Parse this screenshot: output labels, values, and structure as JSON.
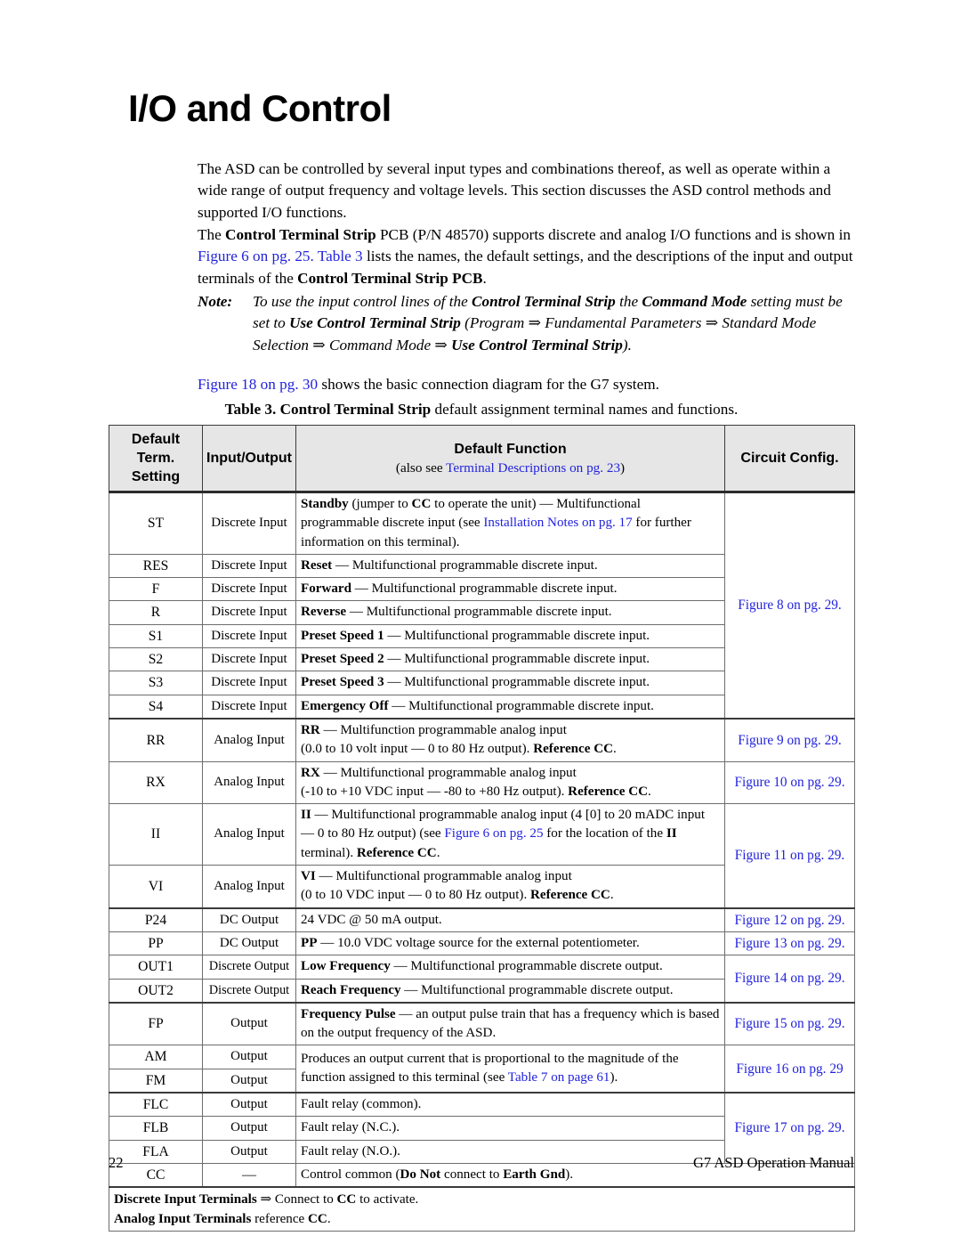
{
  "heading": "I/O and Control",
  "paragraphs": {
    "intro": "The ASD can be controlled by several input types and combinations thereof, as well as operate within a wide range of output frequency and voltage levels. This section discusses the ASD control methods and supported I/O functions.",
    "strip_p1": "The ",
    "strip_b1": "Control Terminal Strip",
    "strip_p2": " PCB (P/N 48570) supports discrete and analog I/O functions and is shown in ",
    "strip_link1": "Figure 6 on pg. 25.",
    "strip_link2": "Table 3",
    "strip_p3": " lists the names, the default settings, and the descriptions of the input and output terminals of the ",
    "strip_b2": "Control Terminal Strip PCB",
    "strip_p4": ".",
    "fig18_link": "Figure 18 on pg. 30",
    "fig18_rest": " shows the basic connection diagram for the G7 system."
  },
  "note": {
    "label": "Note:",
    "seg1": "To use the input control lines of the ",
    "seg2_b": "Control Terminal Strip",
    "seg3": " the ",
    "seg4_b": "Command Mode",
    "seg5": " setting must be set to ",
    "seg6_b": "Use Control Terminal Strip",
    "seg7": " (Program ⇒ Fundamental Parameters ⇒ Standard Mode Selection ⇒ Command Mode ⇒ ",
    "seg8_b": "Use Control Terminal Strip",
    "seg9": ")."
  },
  "table_caption": {
    "prefix": "Table 3. ",
    "bold": "Control Terminal Strip",
    "suffix": " default assignment terminal names and functions."
  },
  "table": {
    "headers": {
      "term": "Default Term. Setting",
      "term_l1": "Default",
      "term_l2": "Term.",
      "term_l3": "Setting",
      "io": "Input/Output",
      "func": "Default Function",
      "func_sub_pre": "(also see ",
      "func_sub_link": "Terminal Descriptions on pg. 23",
      "func_sub_post": ")",
      "cfg": "Circuit Config."
    },
    "rows": [
      {
        "term": "ST",
        "io": "Discrete Input",
        "func_bold": "Standby",
        "func_rest_a": " (jumper to ",
        "func_bold_b": "CC",
        "func_rest_b": " to operate the unit) — Multifunctional programmable discrete input (see ",
        "func_link": "Installation Notes on pg. 17",
        "func_rest_c": " for further information on this terminal).",
        "cfg": ""
      },
      {
        "term": "RES",
        "io": "Discrete Input",
        "func_bold": "Reset",
        "func_rest": " — Multifunctional programmable discrete input.",
        "cfg": ""
      },
      {
        "term": "F",
        "io": "Discrete Input",
        "func_bold": "Forward",
        "func_rest": " — Multifunctional programmable discrete input.",
        "cfg": ""
      },
      {
        "term": "R",
        "io": "Discrete Input",
        "func_bold": "Reverse",
        "func_rest": " — Multifunctional programmable discrete input.",
        "cfg": "Figure 8 on pg. 29."
      },
      {
        "term": "S1",
        "io": "Discrete Input",
        "func_bold": "Preset Speed 1",
        "func_rest": " — Multifunctional programmable discrete input.",
        "cfg": ""
      },
      {
        "term": "S2",
        "io": "Discrete Input",
        "func_bold": "Preset Speed 2",
        "func_rest": " — Multifunctional programmable discrete input.",
        "cfg": ""
      },
      {
        "term": "S3",
        "io": "Discrete Input",
        "func_bold": "Preset Speed 3",
        "func_rest": " — Multifunctional programmable discrete input.",
        "cfg": ""
      },
      {
        "term": "S4",
        "io": "Discrete Input",
        "func_bold": "Emergency Off",
        "func_rest": " — Multifunctional programmable discrete input.",
        "cfg": ""
      },
      {
        "term": "RR",
        "io": "Analog Input",
        "func_bold": "RR",
        "func_rest_a": " — Multifunction programmable analog input",
        "func_line2": "(0.0 to 10 volt input — 0 to 80 Hz output). ",
        "func_bold_b": "Reference CC",
        "func_rest_c": ".",
        "cfg": "Figure 9 on pg. 29."
      },
      {
        "term": "RX",
        "io": "Analog Input",
        "func_bold": "RX",
        "func_rest_a": " — Multifunctional programmable analog input",
        "func_line2": "(-10 to +10 VDC input — -80 to +80 Hz output). ",
        "func_bold_b": "Reference CC",
        "func_rest_c": ".",
        "cfg": "Figure 10 on pg. 29."
      },
      {
        "term": "II",
        "io": "Analog Input",
        "func_bold": "II",
        "func_rest_a": " — Multifunctional programmable analog input (4 [0] to 20 mADC input — 0 to 80 Hz output) (see ",
        "func_link": "Figure 6 on pg. 25",
        "func_rest_b": " for the location of the ",
        "func_bold_b": "II",
        "func_rest_c": " terminal). ",
        "func_bold_c": "Reference CC",
        "func_rest_d": ".",
        "cfg": "Figure 11 on pg. 29."
      },
      {
        "term": "VI",
        "io": "Analog Input",
        "func_bold": "VI",
        "func_rest_a": " — Multifunctional programmable analog input",
        "func_line2": "(0 to 10 VDC input — 0 to 80 Hz output). ",
        "func_bold_b": "Reference CC",
        "func_rest_c": ".",
        "cfg": ""
      },
      {
        "term": "P24",
        "io": "DC Output",
        "func_plain": "24 VDC @ 50 mA output.",
        "cfg": "Figure 12 on pg. 29."
      },
      {
        "term": "PP",
        "io": "DC Output",
        "func_bold": "PP",
        "func_rest": " — 10.0 VDC voltage source for the external potentiometer.",
        "cfg": "Figure 13 on pg. 29."
      },
      {
        "term": "OUT1",
        "io": "Discrete Output",
        "func_bold": "Low Frequency",
        "func_rest": " — Multifunctional programmable discrete output.",
        "cfg": "Figure 14 on pg. 29."
      },
      {
        "term": "OUT2",
        "io": "Discrete Output",
        "func_bold": "Reach Frequency",
        "func_rest": " — Multifunctional programmable discrete output.",
        "cfg": ""
      },
      {
        "term": "FP",
        "io": "Output",
        "func_bold": "Frequency Pulse",
        "func_rest_a": " — an output pulse train that has a frequency which is based on the output frequency of the ASD.",
        "cfg": "Figure 15 on pg. 29."
      },
      {
        "term": "AM",
        "io": "Output",
        "func_plain_a": "Produces an output current that is proportional to the magnitude of the function assigned to this terminal (see ",
        "func_link": "Table 7 on page 61",
        "func_plain_b": ").",
        "cfg": "Figure 16 on pg. 29"
      },
      {
        "term": "FM",
        "io": "Output",
        "func_plain": "",
        "cfg": ""
      },
      {
        "term": "FLC",
        "io": "Output",
        "func_plain": "Fault relay (common).",
        "cfg": ""
      },
      {
        "term": "FLB",
        "io": "Output",
        "func_plain": "Fault relay (N.C.).",
        "cfg": "Figure 17 on pg. 29."
      },
      {
        "term": "FLA",
        "io": "Output",
        "func_plain": "Fault relay (N.O.).",
        "cfg": ""
      },
      {
        "term": "CC",
        "io": "—",
        "func_plain_a": "Control common (",
        "func_bold": "Do Not",
        "func_plain_b": " connect to ",
        "func_bold_b": "Earth Gnd",
        "func_plain_c": ").",
        "cfg": ""
      }
    ],
    "footnotes": {
      "line1_bold": "Discrete Input Terminals",
      "line1_rest_a": " ⇒ Connect to ",
      "line1_bold_b": "CC",
      "line1_rest_b": " to activate.",
      "line2_bold": "Analog Input Terminals",
      "line2_rest": " reference ",
      "line2_bold_b": "CC",
      "line2_rest_b": "."
    }
  },
  "footer": {
    "page_number": "22",
    "manual_title": "G7 ASD Operation Manual"
  },
  "colors": {
    "link": "#2222dd",
    "header_bg": "#e6e6e6",
    "border": "#6d6d6d",
    "text": "#000000"
  }
}
